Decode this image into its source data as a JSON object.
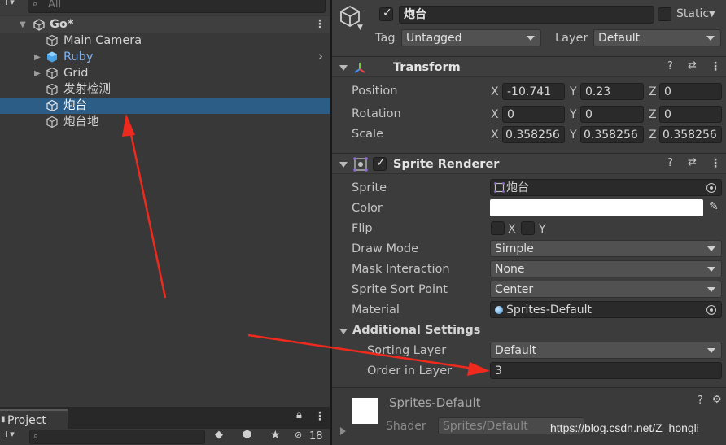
{
  "hierarchy": {
    "search_placeholder": "All",
    "scene_name": "Go*",
    "items": [
      {
        "label": "Main Camera",
        "color": "#d2d2d2"
      },
      {
        "label": "Ruby",
        "color": "#7fb2f0"
      },
      {
        "label": "Grid",
        "color": "#d2d2d2"
      },
      {
        "label": "发射检测",
        "color": "#d2d2d2"
      },
      {
        "label": "炮台",
        "color": "#ffffff"
      },
      {
        "label": "炮台地",
        "color": "#d2d2d2"
      }
    ],
    "selection_color": "#2c5d87"
  },
  "project": {
    "tab_label": "Project",
    "hidden_count": "18"
  },
  "inspector": {
    "object_name": "炮台",
    "static_label": "Static",
    "tag_label": "Tag",
    "tag_value": "Untagged",
    "layer_label": "Layer",
    "layer_value": "Default",
    "transform": {
      "title": "Transform",
      "position_label": "Position",
      "rotation_label": "Rotation",
      "scale_label": "Scale",
      "axis_x": "X",
      "axis_y": "Y",
      "axis_z": "Z",
      "position": {
        "x": "-10.741",
        "y": "0.23",
        "z": "0"
      },
      "rotation": {
        "x": "0",
        "y": "0",
        "z": "0"
      },
      "scale": {
        "x": "0.358256",
        "y": "0.358256",
        "z": "0.358256"
      }
    },
    "sprite_renderer": {
      "title": "Sprite Renderer",
      "sprite_label": "Sprite",
      "sprite_value": "炮台",
      "color_label": "Color",
      "color_value": "#ffffff",
      "flip_label": "Flip",
      "flip_x": "X",
      "flip_y": "Y",
      "draw_mode_label": "Draw Mode",
      "draw_mode_value": "Simple",
      "mask_label": "Mask Interaction",
      "mask_value": "None",
      "sort_point_label": "Sprite Sort Point",
      "sort_point_value": "Center",
      "material_label": "Material",
      "material_value": "Sprites-Default",
      "additional_label": "Additional Settings",
      "sorting_layer_label": "Sorting Layer",
      "sorting_layer_value": "Default",
      "order_label": "Order in Layer",
      "order_value": "3"
    },
    "material": {
      "name": "Sprites-Default",
      "shader_label": "Shader",
      "shader_value": "Sprites/Default"
    }
  },
  "watermark": "https://blog.csdn.net/Z_hongli",
  "annotation_color": "#ee2a1e"
}
